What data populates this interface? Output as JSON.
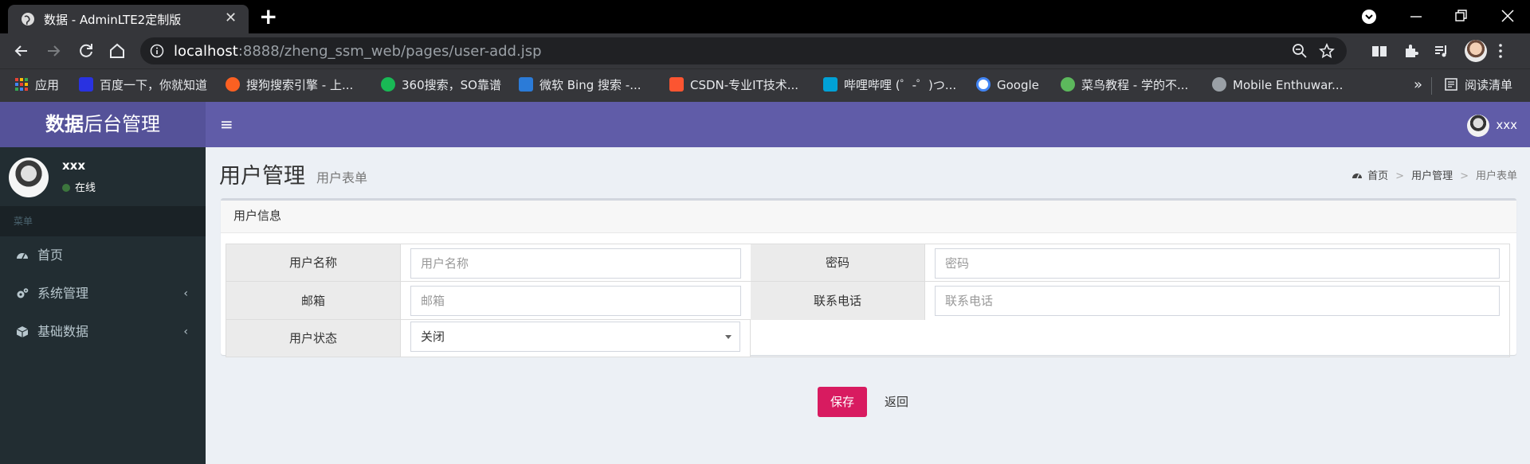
{
  "browser": {
    "tab_title": "数据 - AdminLTE2定制版",
    "close_glyph": "✕",
    "new_tab_glyph": "+",
    "url_host": "localhost",
    "url_rest": ":8888/zheng_ssm_web/pages/user-add.jsp",
    "bookmarks": [
      {
        "label": "应用",
        "color": "#e8453c"
      },
      {
        "label": "百度一下，你就知道",
        "color": "#2932e1"
      },
      {
        "label": "搜狗搜索引擎 - 上...",
        "color": "#fb6022"
      },
      {
        "label": "360搜索，SO靠谱",
        "color": "#19b955"
      },
      {
        "label": "微软 Bing 搜索 -...",
        "color": "#2b7bd8"
      },
      {
        "label": "CSDN-专业IT技术...",
        "color": "#fc5531"
      },
      {
        "label": "哔哩哔哩 (゜-゜)つ...",
        "color": "#00a1d6"
      },
      {
        "label": "Google",
        "color": "#4285f4"
      },
      {
        "label": "菜鸟教程 - 学的不...",
        "color": "#5cb85c"
      },
      {
        "label": "Mobile Enthuwar...",
        "color": "#9aa0a6"
      }
    ],
    "overflow_glyph": "»",
    "reading_list": "阅读清单"
  },
  "header": {
    "logo_bold": "数据",
    "logo_rest": "后台管理",
    "hamburger": "≡",
    "username": "xxx",
    "accent": "#605ca8"
  },
  "sidebar": {
    "username": "xxx",
    "status": "在线",
    "section_header": "菜单",
    "items": [
      {
        "label": "首页",
        "icon": "dashboard-icon"
      },
      {
        "label": "系统管理",
        "icon": "gears-icon",
        "chevron": "‹"
      },
      {
        "label": "基础数据",
        "icon": "cube-icon",
        "chevron": "‹"
      }
    ]
  },
  "page": {
    "title": "用户管理",
    "subtitle": "用户表单",
    "breadcrumb": [
      "首页",
      "用户管理",
      "用户表单"
    ],
    "breadcrumb_sep": ">"
  },
  "form": {
    "box_title": "用户信息",
    "username_label": "用户名称",
    "username_placeholder": "用户名称",
    "password_label": "密码",
    "password_placeholder": "密码",
    "email_label": "邮箱",
    "email_placeholder": "邮箱",
    "phone_label": "联系电话",
    "phone_placeholder": "联系电话",
    "status_label": "用户状态",
    "status_value": "关闭"
  },
  "actions": {
    "save_label": "保存",
    "back_label": "返回",
    "save_color": "#d81b60"
  }
}
